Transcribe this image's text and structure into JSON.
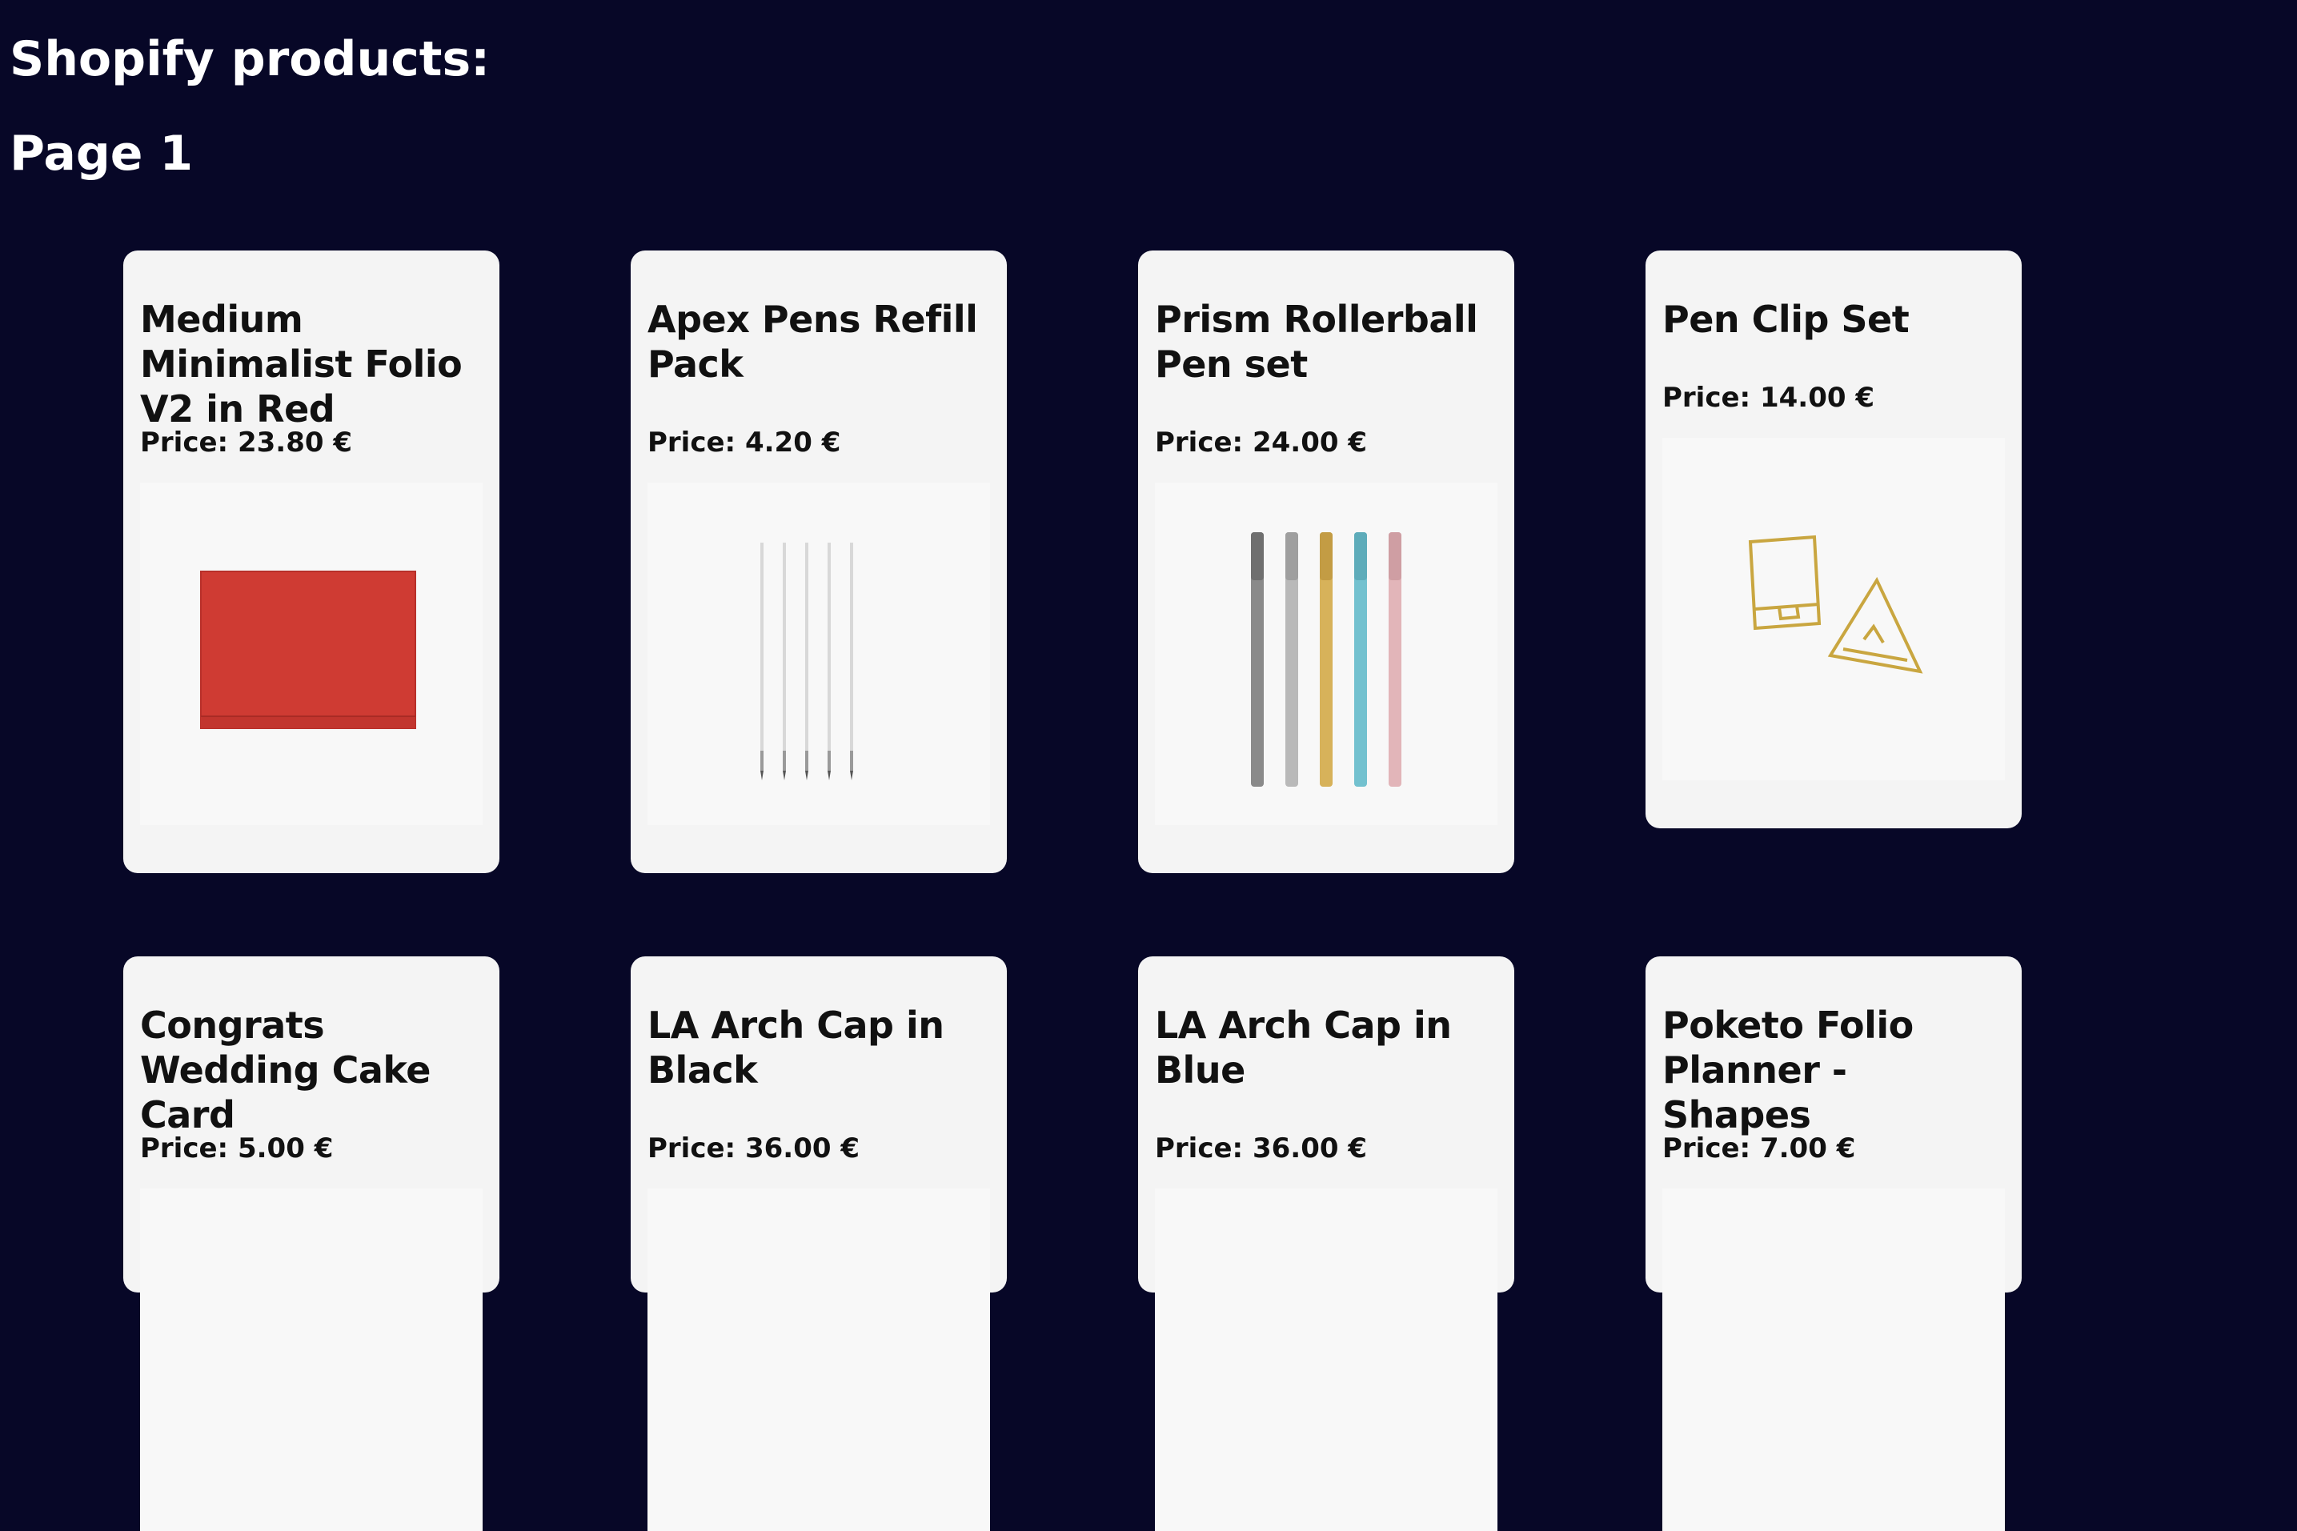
{
  "header": {
    "title": "Shopify products:",
    "page_label": "Page 1"
  },
  "products": [
    {
      "title": "Medium Minimalist Folio V2 in Red",
      "price": "Price: 23.80 €",
      "image_icon": "red-folio-image"
    },
    {
      "title": "Apex Pens Refill Pack",
      "price": "Price: 4.20 €",
      "image_icon": "pen-refills-image"
    },
    {
      "title": "Prism Rollerball Pen set",
      "price": "Price: 24.00 €",
      "image_icon": "rollerball-pens-image"
    },
    {
      "title": "Pen Clip Set",
      "price": "Price: 14.00 €",
      "image_icon": "gold-pen-clips-image"
    },
    {
      "title": "Congrats Wedding Cake Card",
      "price": "Price: 5.00 €",
      "image_icon": "card-image"
    },
    {
      "title": "LA Arch Cap in Black",
      "price": "Price: 36.00 €",
      "image_icon": "cap-image"
    },
    {
      "title": "LA Arch Cap in Blue",
      "price": "Price: 36.00 €",
      "image_icon": "cap-image"
    },
    {
      "title": "Poketo Folio Planner - Shapes",
      "price": "Price: 7.00 €",
      "image_icon": "planner-image"
    }
  ],
  "colors": {
    "background": "#070727",
    "card": "#f4f4f4",
    "text_dark": "#111111",
    "text_light": "#ffffff"
  }
}
